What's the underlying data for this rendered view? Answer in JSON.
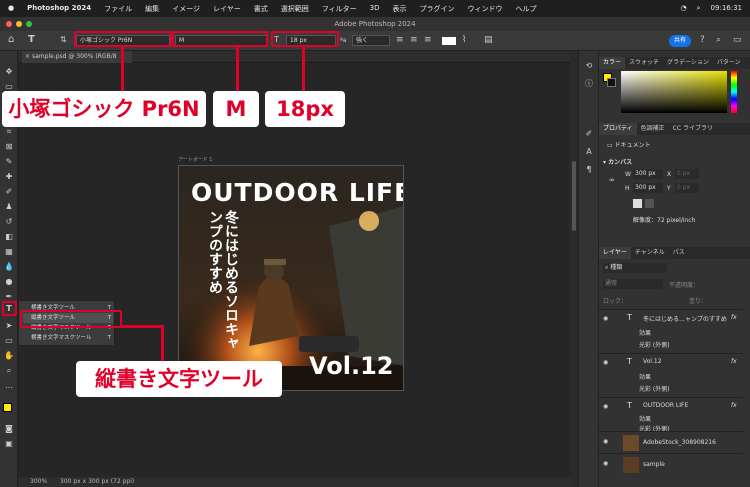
{
  "menubar": {
    "app": "Photoshop 2024",
    "items": [
      "ファイル",
      "編集",
      "イメージ",
      "レイヤー",
      "書式",
      "選択範囲",
      "フィルター",
      "3D",
      "表示",
      "プラグイン",
      "ウィンドウ",
      "ヘルプ"
    ],
    "clock": "09:16:31"
  },
  "window": {
    "title": "Adobe Photoshop 2024"
  },
  "options": {
    "font_family": "小塚ゴシック Pr6N",
    "font_style": "M",
    "font_size": "18 px",
    "aa": "強く",
    "aa_label": "ªa",
    "share": "共有"
  },
  "document": {
    "tab": "sample.psd @ 300% (RGB/8",
    "artboard": "アートボード 1",
    "zoom": "300%",
    "size": "300 px x 300 px (72 ppi)"
  },
  "artwork": {
    "headline": "OUTDOOR LIFE",
    "vertical": "冬にはじめるソロキャンプのすすめ",
    "issue": "Vol.12"
  },
  "flyout": {
    "items": [
      "横書き文字ツール",
      "縦書き文字ツール",
      "横書き文字マスクツール",
      "縦書き文字マスクツール"
    ],
    "shortcut": "T"
  },
  "panels": {
    "color_tabs": [
      "カラー",
      "スウォッチ",
      "グラデーション",
      "パターン"
    ],
    "prop_tabs": [
      "プロパティ",
      "色調補正",
      "CC ライブラリ"
    ],
    "prop_doc": "ドキュメント",
    "canvas_label": "カンバス",
    "w": "300 px",
    "h": "300 px",
    "w_label": "W",
    "h_label": "H",
    "x_label": "X",
    "y_label": "Y",
    "x_ph": "0 px",
    "y_ph": "0 px",
    "resolution": "解像度：72 pixel/inch",
    "layer_tabs": [
      "レイヤー",
      "チャンネル",
      "パス"
    ],
    "kind": "種類",
    "blend": "通常",
    "opacity": "不透明度：",
    "lock": "ロック：",
    "fill": "塗り：",
    "layers": [
      {
        "name": "冬にはじめる…ャンプのすすめ",
        "type": "T",
        "effect": "効果",
        "sub": "光彩 (外側)"
      },
      {
        "name": "Vol.12",
        "type": "T",
        "effect": "効果",
        "sub": "光彩 (外側)"
      },
      {
        "name": "OUTDOOR LIFE",
        "type": "T",
        "effect": "効果",
        "sub": "光彩 (外側)"
      },
      {
        "name": "AdobeStock_308908216",
        "type": "img"
      },
      {
        "name": "sample",
        "type": "img"
      }
    ]
  },
  "callouts": {
    "font": "小塚ゴシック Pr6N",
    "style": "M",
    "size": "18px",
    "tool": "縦書き文字ツール"
  },
  "colors": {
    "accent": "#e1002a",
    "share": "#1473e6"
  }
}
